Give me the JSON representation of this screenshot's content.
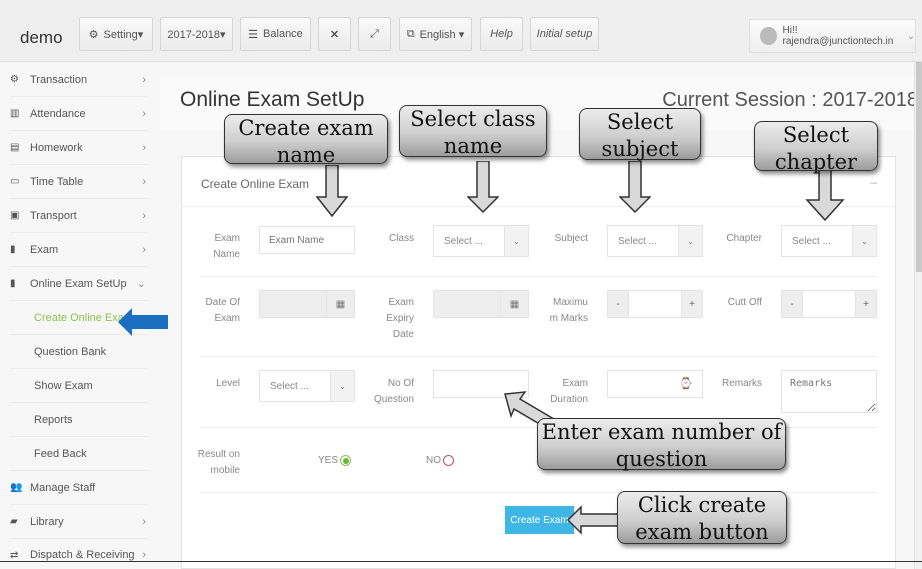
{
  "topbar": {
    "brand": "demo",
    "buttons": [
      {
        "icon": "gear-icon",
        "label": "Setting▾"
      },
      {
        "label": "2017-2018▾"
      },
      {
        "icon": "database-icon",
        "label": "Balance"
      },
      {
        "icon": "fullscreen-icon",
        "label": "⤧"
      },
      {
        "icon": "expand-icon",
        "label": "⤢"
      },
      {
        "icon": "language-icon",
        "label": "English ▾"
      },
      {
        "label": "Help"
      },
      {
        "label": "Initial setup"
      }
    ],
    "user": "Hi!! rajendra@junctiontech.in",
    "user_chevron": "⌄"
  },
  "sidebar": {
    "items": [
      {
        "icon": "⚙",
        "label": "Transaction",
        "chevron": "›"
      },
      {
        "icon": "▥",
        "label": "Attendance",
        "chevron": "›"
      },
      {
        "icon": "▤",
        "label": "Homework",
        "chevron": "›"
      },
      {
        "icon": "▭",
        "label": "Time Table",
        "chevron": "›"
      },
      {
        "icon": "▣",
        "label": "Transport",
        "chevron": "›"
      },
      {
        "icon": "▮",
        "label": "Exam",
        "chevron": "›"
      },
      {
        "icon": "▮",
        "label": "Online Exam SetUp",
        "chevron": "⌄"
      }
    ],
    "subitems": [
      {
        "label": "Create Online Exam",
        "active": true
      },
      {
        "label": "Question Bank"
      },
      {
        "label": "Show Exam"
      },
      {
        "label": "Reports"
      },
      {
        "label": "Feed Back"
      }
    ],
    "more": [
      {
        "icon": "👥",
        "label": "Manage Staff"
      },
      {
        "icon": "▰",
        "label": "Library",
        "chevron": "›"
      },
      {
        "icon": "⇄",
        "label": "Dispatch & Receiving",
        "chevron": "›"
      }
    ]
  },
  "main": {
    "title": "Online Exam SetUp",
    "session": "Current Session : 2017-2018",
    "panel_title": "Create Online Exam",
    "panel_collapse": "–",
    "fields": {
      "exam_name": {
        "label": "Exam Name",
        "placeholder": "Exam Name"
      },
      "class": {
        "label": "Class",
        "value": "Select ..."
      },
      "subject": {
        "label": "Subject",
        "value": "Select ..."
      },
      "chapter": {
        "label": "Chapter",
        "value": "Select ..."
      },
      "date_of_exam": {
        "label": "Date Of Exam"
      },
      "expiry_date": {
        "label": "Exam Expiry Date"
      },
      "max_marks": {
        "label": "Maximu m Marks",
        "minus": "-",
        "plus": "+"
      },
      "cut_off": {
        "label": "Cutt Off",
        "minus": "-",
        "plus": "+"
      },
      "level": {
        "label": "Level",
        "value": "Select ..."
      },
      "no_of_question": {
        "label": "No Of Question"
      },
      "exam_duration": {
        "label": "Exam Duration"
      },
      "remarks": {
        "label": "Remarks",
        "placeholder": "Remarks"
      },
      "result_on_mobile": {
        "label": "Result on mobile",
        "yes": "YES",
        "no": "NO",
        "selected": "YES"
      }
    },
    "create_button": "Create Exam"
  },
  "callouts": {
    "exam_name": "Create exam name",
    "class_name": "Select class name",
    "subject": "Select subject",
    "chapter": "Select chapter",
    "no_of_question": "Enter exam number of question",
    "create_button": "Click create exam button"
  },
  "colors": {
    "accent_green": "#8bc34a",
    "button_blue": "#3fb6e4",
    "arrow_blue": "#1a6fc0"
  }
}
